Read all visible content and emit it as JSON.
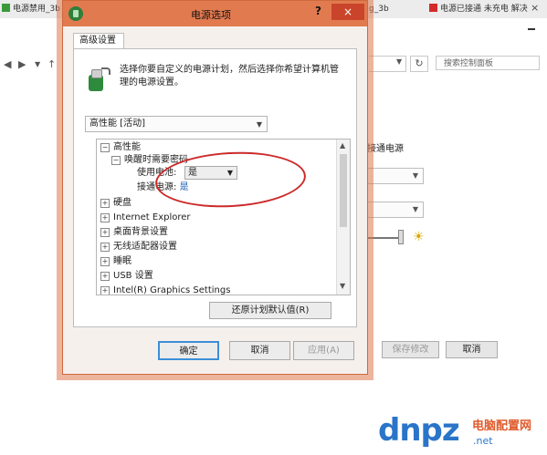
{
  "browser": {
    "tabs": [
      {
        "label": "电源禁用_3b"
      },
      {
        "label": "g_3b"
      },
      {
        "label": "电源已接通 未充电 解决"
      }
    ],
    "tab_close": "×"
  },
  "control_panel": {
    "search_placeholder": "搜索控制面板",
    "plugged_in_label": "接通电源",
    "buttons": {
      "save": "保存修改",
      "cancel": "取消"
    }
  },
  "dialog": {
    "title": "电源选项",
    "help_glyph": "?",
    "close_glyph": "×",
    "tab_label": "高级设置",
    "description": "选择你要自定义的电源计划，然后选择你希望计算机管理的电源设置。",
    "plan_selected": "高性能 [活动]",
    "tree": {
      "root": "高性能",
      "child": "唤醒时需要密码",
      "battery_label": "使用电池:",
      "battery_value": "是",
      "plugged_label": "接通电源:",
      "plugged_value": "是",
      "items": [
        "硬盘",
        "Internet Explorer",
        "桌面背景设置",
        "无线适配器设置",
        "睡眠",
        "USB 设置",
        "Intel(R) Graphics Settings"
      ]
    },
    "restore_button": "还原计划默认值(R)",
    "buttons": {
      "ok": "确定",
      "cancel": "取消",
      "apply": "应用(A)"
    }
  },
  "watermark": {
    "brand": "dnpz",
    "brand_cn": "电脑配置网",
    "url": ".net"
  }
}
